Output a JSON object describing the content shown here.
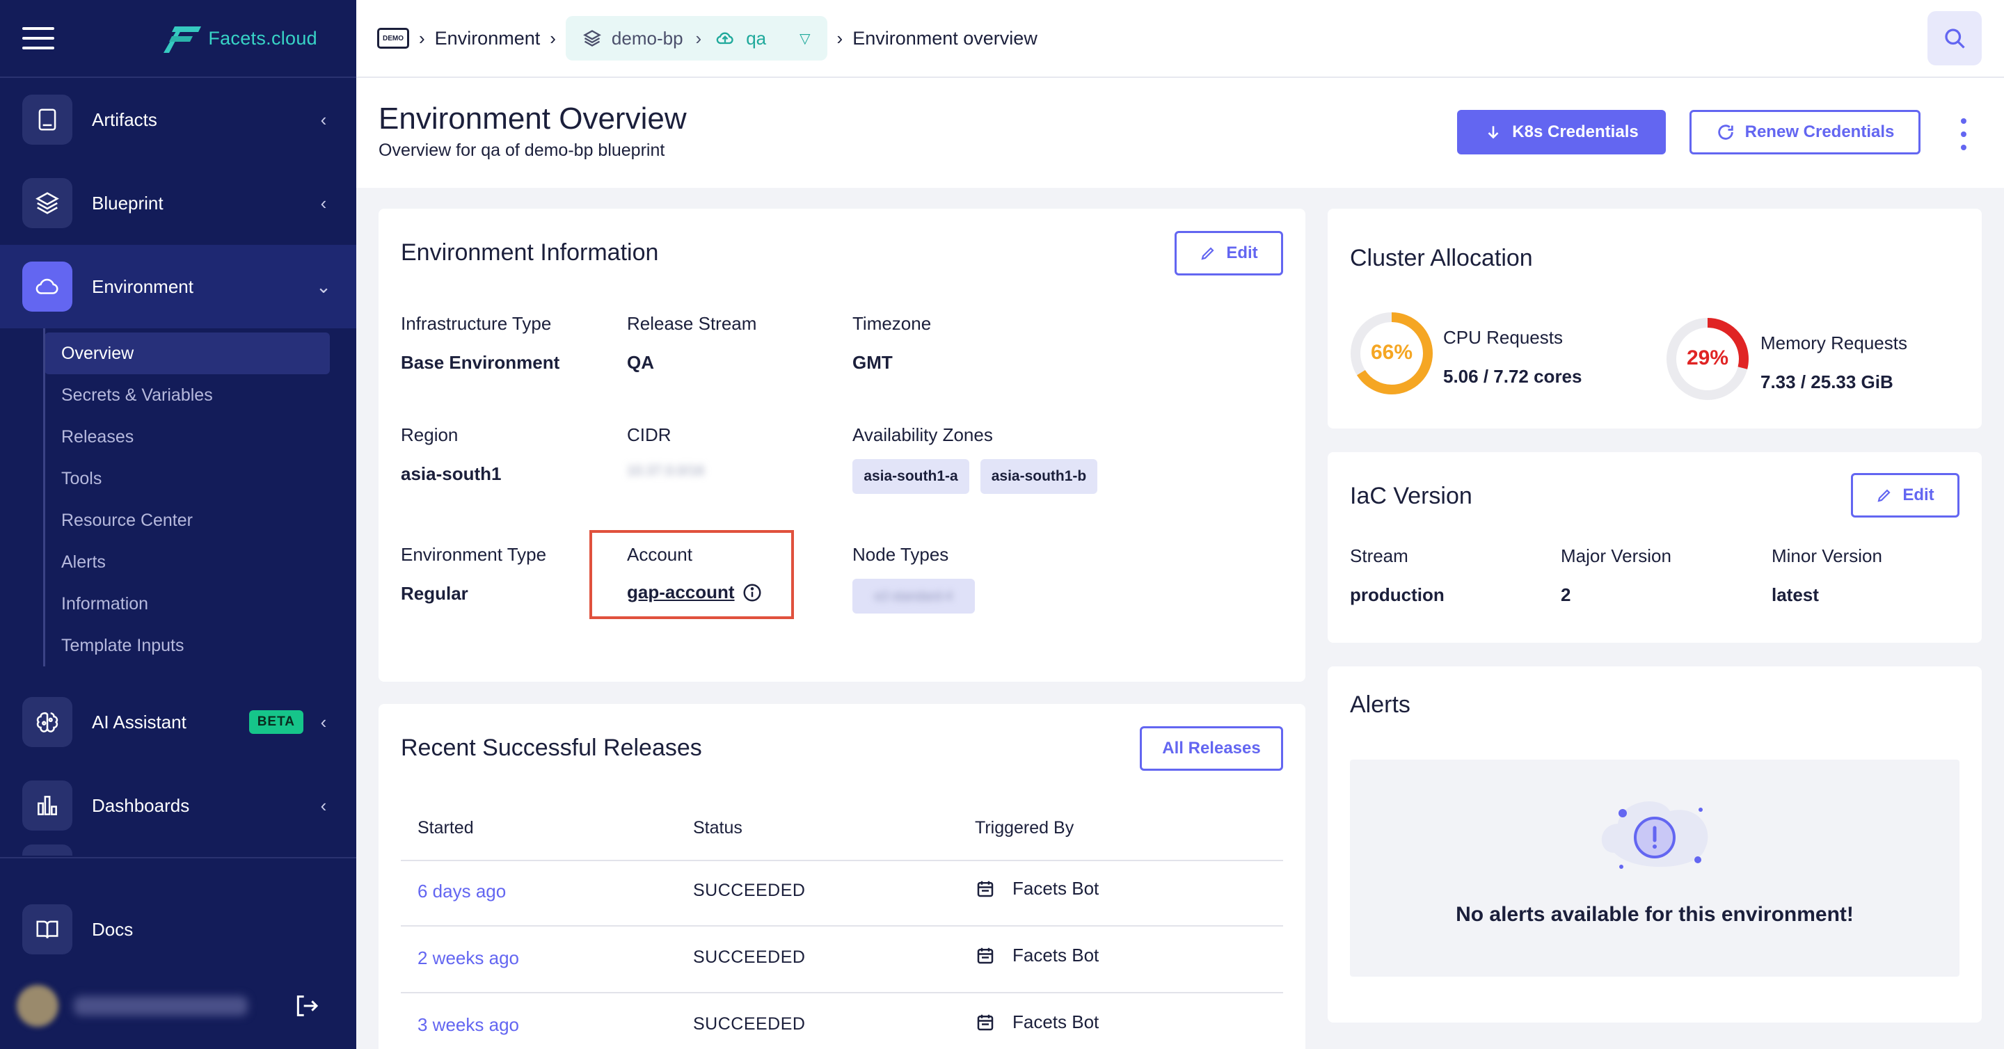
{
  "app": {
    "logo_text": "Facets.cloud"
  },
  "sidebar": {
    "items": [
      {
        "label": "Artifacts",
        "icon": "book-icon"
      },
      {
        "label": "Blueprint",
        "icon": "layers-icon"
      },
      {
        "label": "Environment",
        "icon": "cloud-icon"
      },
      {
        "label": "AI Assistant",
        "icon": "brain-icon",
        "badge": "BETA"
      },
      {
        "label": "Dashboards",
        "icon": "bar-chart-icon"
      }
    ],
    "sub_items": [
      "Overview",
      "Secrets & Variables",
      "Releases",
      "Tools",
      "Resource Center",
      "Alerts",
      "Information",
      "Template Inputs"
    ],
    "docs_label": "Docs"
  },
  "topbar": {
    "demo_badge": "DEMO",
    "crumb_environment": "Environment",
    "blueprint": "demo-bp",
    "environment": "qa",
    "crumb_current": "Environment overview"
  },
  "header": {
    "title": "Environment Overview",
    "subtitle": "Overview for qa of demo-bp blueprint",
    "k8s_button": "K8s Credentials",
    "renew_button": "Renew Credentials"
  },
  "env_info": {
    "title": "Environment Information",
    "edit": "Edit",
    "infra_type_label": "Infrastructure Type",
    "infra_type": "Base Environment",
    "release_stream_label": "Release Stream",
    "release_stream": "QA",
    "timezone_label": "Timezone",
    "timezone": "GMT",
    "region_label": "Region",
    "region": "asia-south1",
    "cidr_label": "CIDR",
    "cidr": "10.37.0.0/16",
    "az_label": "Availability Zones",
    "zones": [
      "asia-south1-a",
      "asia-south1-b"
    ],
    "env_type_label": "Environment Type",
    "env_type": "Regular",
    "account_label": "Account",
    "account": "gap-account",
    "node_types_label": "Node Types",
    "node_type": "e2-standard-4"
  },
  "releases": {
    "title": "Recent Successful Releases",
    "all_button": "All Releases",
    "columns": [
      "Started",
      "Status",
      "Triggered By"
    ],
    "rows": [
      {
        "started": "6 days ago",
        "status": "SUCCEEDED",
        "by": "Facets Bot"
      },
      {
        "started": "2 weeks ago",
        "status": "SUCCEEDED",
        "by": "Facets Bot"
      },
      {
        "started": "3 weeks ago",
        "status": "SUCCEEDED",
        "by": "Facets Bot"
      }
    ]
  },
  "cluster": {
    "title": "Cluster Allocation",
    "cpu": {
      "label": "CPU Requests",
      "value": "5.06 / 7.72 cores",
      "percent_text": "66%",
      "fraction": 0.66,
      "color": "#f5a623"
    },
    "memory": {
      "label": "Memory Requests",
      "value": "7.33 / 25.33 GiB",
      "percent_text": "29%",
      "fraction": 0.29,
      "color": "#e02424"
    }
  },
  "iac": {
    "title": "IaC Version",
    "edit": "Edit",
    "stream_label": "Stream",
    "stream": "production",
    "major_label": "Major Version",
    "major": "2",
    "minor_label": "Minor Version",
    "minor": "latest"
  },
  "alerts": {
    "title": "Alerts",
    "empty_message": "No alerts available for this environment!"
  },
  "user": {
    "name": "david.mitchell@facets"
  }
}
